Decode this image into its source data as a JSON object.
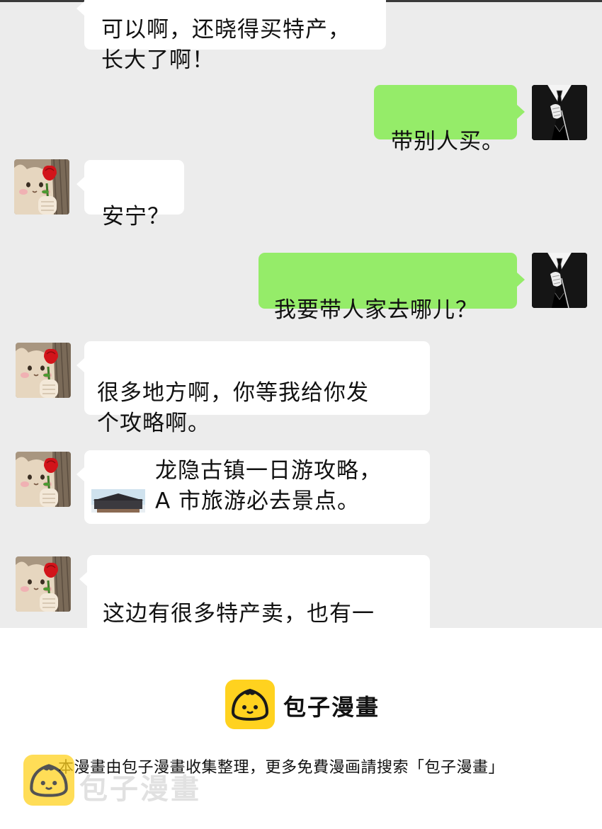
{
  "chat": {
    "messages": [
      {
        "side": "incoming",
        "text": "可以啊，还晓得买特产，\n长大了啊！"
      },
      {
        "side": "outgoing",
        "text": "带别人买。"
      },
      {
        "side": "incoming",
        "text": "安宁？"
      },
      {
        "side": "outgoing",
        "text": "我要带人家去哪儿？"
      },
      {
        "side": "incoming",
        "text": "很多地方啊，你等我给你发\n个攻略啊。"
      },
      {
        "side": "incoming",
        "type": "link",
        "text": "龙隐古镇一日游攻略，\nA 市旅游必去景点。"
      },
      {
        "side": "incoming",
        "text": "这边有很多特产卖，也有一\n些特色小吃，你们可以顺便"
      }
    ]
  },
  "footer": {
    "brand": "包子漫畫",
    "note": "本漫畫由包子漫畫收集整理，更多免費漫画請搜索「包子漫畫」",
    "watermark": "包子漫畫"
  },
  "colors": {
    "chat_background": "#ececec",
    "outgoing_bubble": "#95ec69",
    "incoming_bubble": "#ffffff",
    "logo_yellow": "#ffd21f"
  },
  "icons": {
    "incoming_avatar": "cat-holding-rose-avatar",
    "outgoing_avatar": "black-suit-avatar",
    "link_thumbnail": "ancient-town-bridge-thumbnail",
    "brand_logo": "bun-logo-icon"
  }
}
